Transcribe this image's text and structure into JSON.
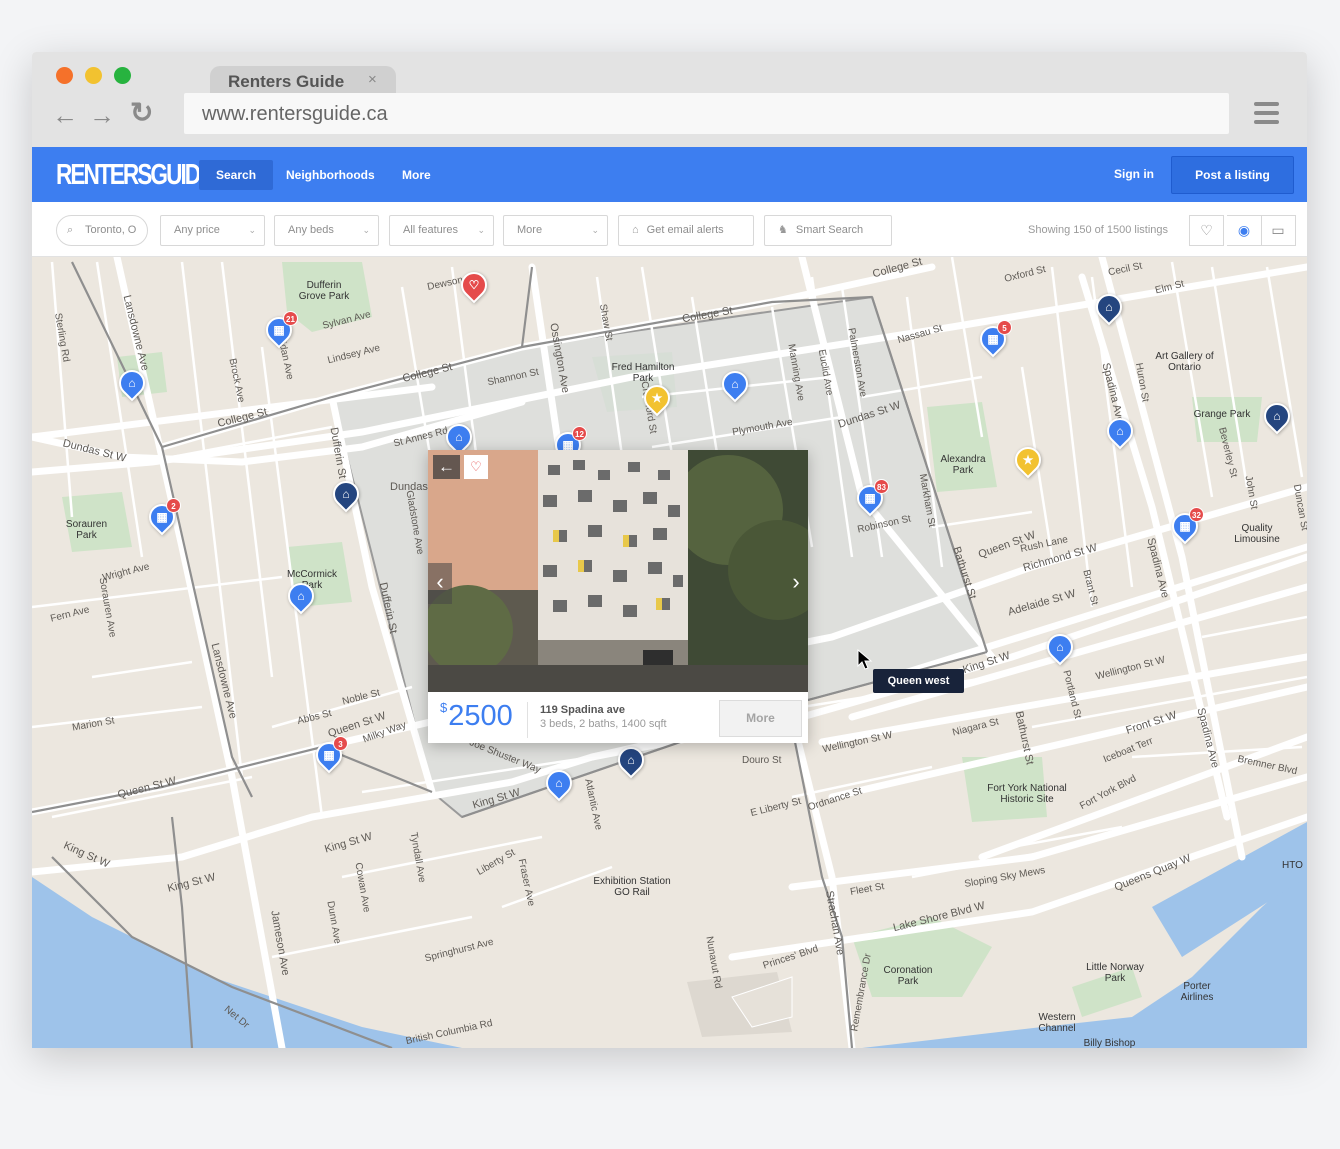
{
  "browser": {
    "tab_title": "Renters Guide",
    "tab_close": "×",
    "url": "www.rentersguide.ca",
    "back_icon": "←",
    "forward_icon": "→",
    "reload_icon": "↻",
    "window_buttons": {
      "close": "#f5712a",
      "minimize": "#f2c230",
      "maximize": "#27b33f"
    }
  },
  "header": {
    "logo": "RENTERSGUIDE",
    "nav": [
      {
        "label": "Search",
        "active": true
      },
      {
        "label": "Neighborhoods",
        "active": false
      },
      {
        "label": "More",
        "active": false
      }
    ],
    "sign_in": "Sign in",
    "post_listing": "Post a listing",
    "accent": "#3d7ef0"
  },
  "filters": {
    "location": "Toronto, O",
    "price": "Any price",
    "beds": "Any beds",
    "features": "All features",
    "more": "More",
    "email_alerts": "Get email alerts",
    "smart_search": "Smart Search",
    "showing": "Showing 150 of 1500 listings",
    "view_icons": [
      "heart-icon",
      "map-pin-icon",
      "list-icon"
    ]
  },
  "popup": {
    "currency": "$",
    "price": "2500",
    "address": "119 Spadina ave",
    "details": "3 beds, 2 baths, 1400 sqft",
    "more_button": "More",
    "back_icon": "←",
    "favorite_icon": "♡",
    "prev_icon": "‹",
    "next_icon": "›"
  },
  "tooltip": "Queen west",
  "map": {
    "streets": [
      "College St",
      "College St",
      "College St",
      "College St",
      "Dundas St W",
      "Dundas St W",
      "Dundas",
      "Queen St W",
      "Queen St W",
      "Queen St W",
      "King St W",
      "King St W",
      "King St W",
      "King St W",
      "King St W",
      "Adelaide St W",
      "Richmond St W",
      "Wellington St W",
      "Wellington St W",
      "Front St W",
      "Lake Shore Blvd W",
      "Queens Quay W",
      "Bathurst St",
      "Bathurst St",
      "Spadina Ave",
      "Spadina Ave",
      "Spadina Ave",
      "Ossington Ave",
      "Dufferin St",
      "Dufferin St",
      "Lansdowne Ave",
      "Lansdowne Ave",
      "Strachan Ave",
      "Shaw St",
      "Crawford St",
      "Sterling Rd",
      "Brock Ave",
      "Sheridan Ave",
      "Gladstone Ave",
      "Liberty St",
      "Fraser Ave",
      "Atlantic Ave",
      "Shannon St",
      "Dewson St",
      "Sylvan Ave",
      "Lindsey Ave",
      "Noble St",
      "Abbs St",
      "Milky Way",
      "Joe Shuster Way",
      "Douro St",
      "E Liberty St",
      "Ordnance St",
      "Fleet St",
      "Bremner Blvd",
      "Iceboat Terr",
      "Niagara St",
      "Portland St",
      "Brant St",
      "Oxford St",
      "Nassau St",
      "Cecil St",
      "Elm St",
      "Rush Lane",
      "Beverley St",
      "Huron St",
      "John St",
      "Duncan St",
      "Wright Ave",
      "Fern Ave",
      "Marion St",
      "Sorauren Ave",
      "Robinson St",
      "Plymouth Ave",
      "Manning Ave",
      "Euclid Ave",
      "Palmerston Ave",
      "Markham St",
      "St Annes Rd",
      "Springhurst Ave",
      "British Columbia Rd",
      "Princes' Blvd",
      "Nunavut Rd",
      "Remembrance Dr",
      "Jameson Ave",
      "Cowan Ave",
      "Dunn Ave",
      "Net Dr",
      "Sloping Sky Mews",
      "Fort York Blvd",
      "Tyndall Ave"
    ],
    "places": [
      "Dufferin Grove Park",
      "Fred Hamilton Park",
      "McCormick Park",
      "Sorauren Park",
      "Alexandra Park",
      "Grange Park",
      "Art Gallery of Ontario",
      "Quality Limousine",
      "Fort York National Historic Site",
      "Exhibition Station GO Rail",
      "Coronation Park",
      "Little Norway Park",
      "Porter Airlines",
      "Western Channel",
      "Billy Bishop",
      "HTO"
    ],
    "pins": [
      {
        "type": "building",
        "badge": "21"
      },
      {
        "type": "favorite",
        "badge": ""
      },
      {
        "type": "home",
        "badge": ""
      },
      {
        "type": "star",
        "badge": ""
      },
      {
        "type": "home",
        "badge": ""
      },
      {
        "type": "building",
        "badge": "12"
      },
      {
        "type": "home",
        "badge": ""
      },
      {
        "type": "home-dark",
        "badge": ""
      },
      {
        "type": "building",
        "badge": "2"
      },
      {
        "type": "home",
        "badge": ""
      },
      {
        "type": "building",
        "badge": "3"
      },
      {
        "type": "home",
        "badge": ""
      },
      {
        "type": "home-dark",
        "badge": ""
      },
      {
        "type": "building",
        "badge": "83"
      },
      {
        "type": "building",
        "badge": "5"
      },
      {
        "type": "home-dark",
        "badge": ""
      },
      {
        "type": "home",
        "badge": ""
      },
      {
        "type": "star",
        "badge": ""
      },
      {
        "type": "building",
        "badge": "32"
      },
      {
        "type": "home",
        "badge": ""
      },
      {
        "type": "home-dark",
        "badge": ""
      }
    ]
  }
}
